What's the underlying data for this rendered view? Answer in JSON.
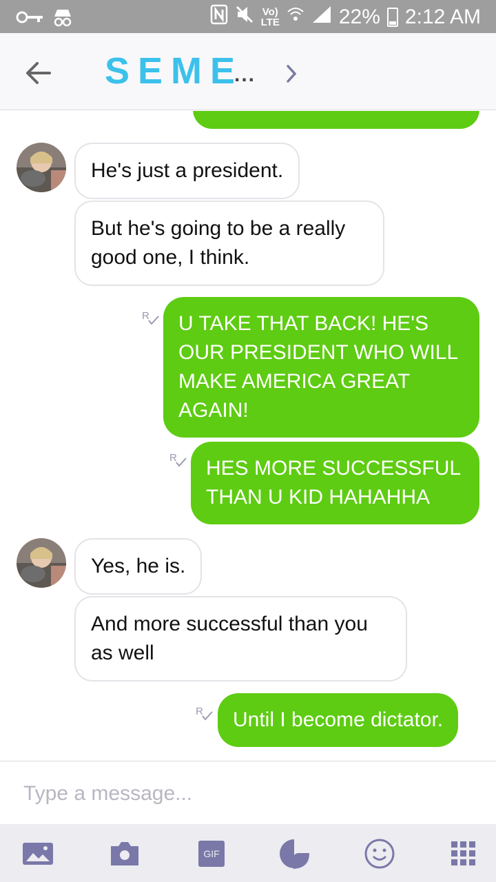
{
  "status_bar": {
    "lte": "LTE",
    "battery": "22%",
    "time": "2:12 AM"
  },
  "header": {
    "title": "SEME",
    "ellipsis": "..."
  },
  "messages": [
    {
      "dir": "in",
      "text": "He's just a president."
    },
    {
      "dir": "in",
      "text": "But he's going to be a really good one, I think."
    },
    {
      "dir": "out",
      "text": "U TAKE THAT BACK! HE'S OUR PRESIDENT WHO WILL MAKE AMERICA GREAT AGAIN!"
    },
    {
      "dir": "out",
      "text": "HES MORE SUCCESSFUL THAN U KID HAHAHHA"
    },
    {
      "dir": "in",
      "text": "Yes, he is."
    },
    {
      "dir": "in",
      "text": "And more successful than you as well"
    },
    {
      "dir": "out",
      "text": "Until I become dictator."
    }
  ],
  "input": {
    "placeholder": "Type a message..."
  },
  "toolbar": {
    "gif_label": "GIF"
  },
  "colors": {
    "accent": "#3cc1ea",
    "outgoing_bubble": "#5ecc12",
    "status_bar": "#9e9e9e"
  },
  "icons": [
    "key-icon",
    "incognito-icon",
    "nfc-icon",
    "mute-icon",
    "wifi-icon",
    "signal-icon",
    "battery-icon",
    "back-arrow-icon",
    "chevron-right-icon",
    "read-receipt-icon",
    "image-icon",
    "camera-icon",
    "gif-icon",
    "sticker-icon",
    "emoji-icon",
    "apps-grid-icon"
  ]
}
